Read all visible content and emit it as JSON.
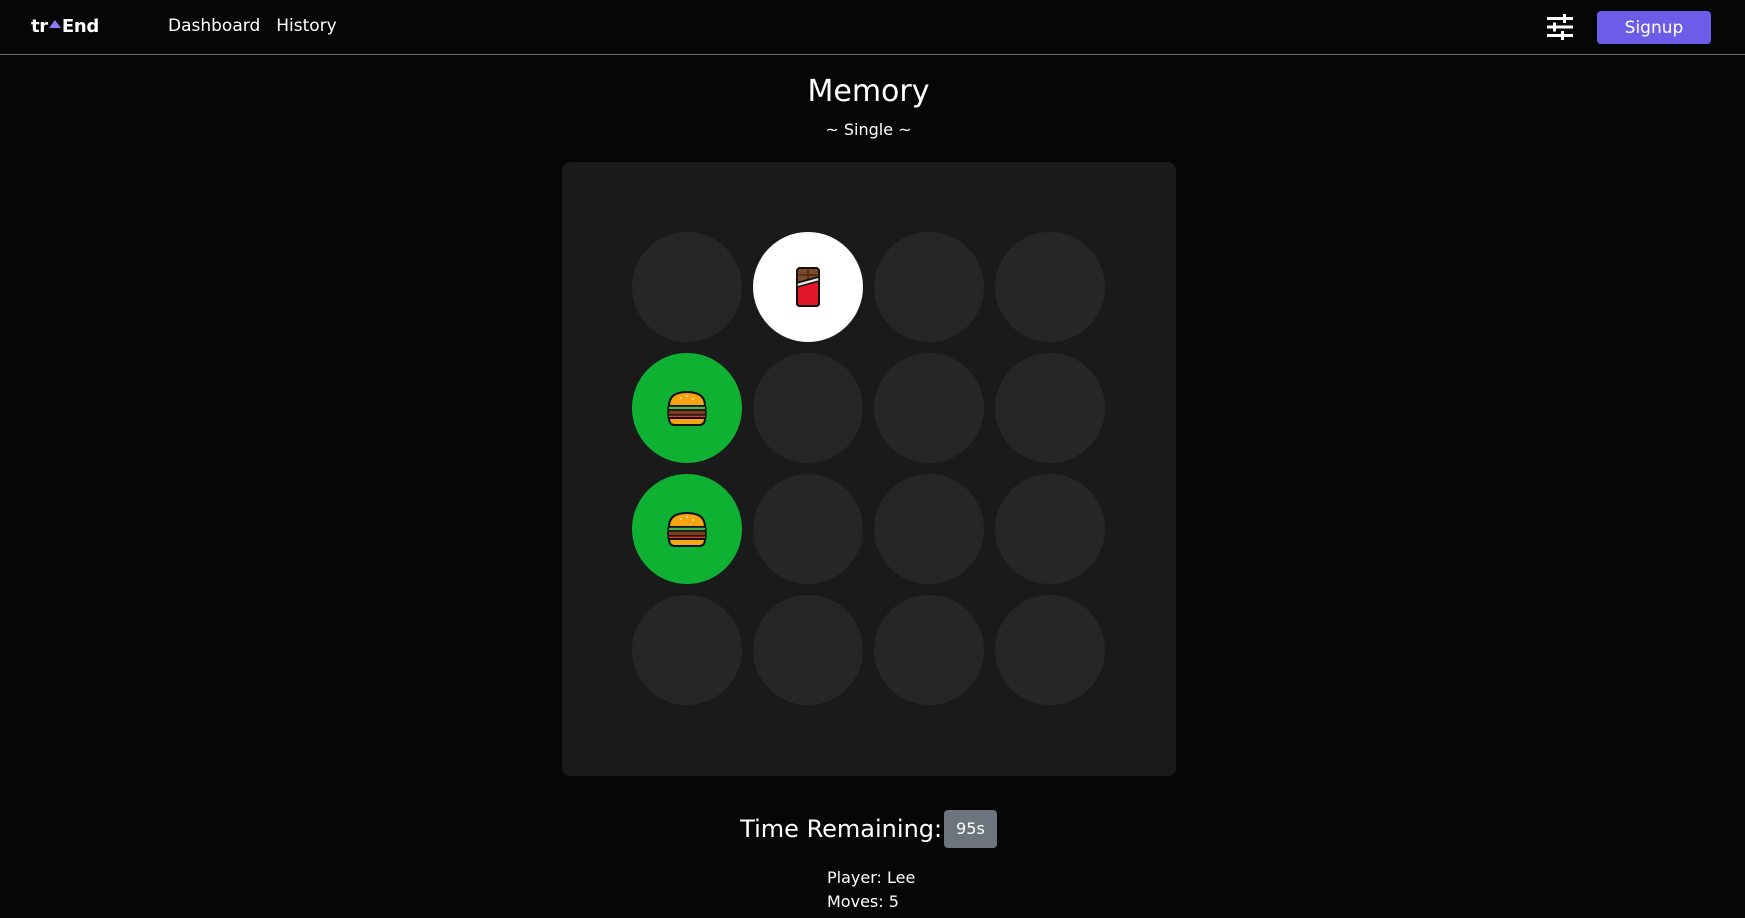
{
  "nav": {
    "logo_left": "tr",
    "logo_right": "End",
    "links": [
      "Dashboard",
      "History"
    ],
    "signup_label": "Signup",
    "settings_icon": "sliders-icon"
  },
  "game": {
    "title": "Memory",
    "mode": "~ Single ~",
    "cards": [
      {
        "state": "hidden",
        "icon": ""
      },
      {
        "state": "revealed",
        "icon": "chocolate-bar-icon"
      },
      {
        "state": "hidden",
        "icon": ""
      },
      {
        "state": "hidden",
        "icon": ""
      },
      {
        "state": "matched",
        "icon": "burger-icon"
      },
      {
        "state": "hidden",
        "icon": ""
      },
      {
        "state": "hidden",
        "icon": ""
      },
      {
        "state": "hidden",
        "icon": ""
      },
      {
        "state": "matched",
        "icon": "burger-icon"
      },
      {
        "state": "hidden",
        "icon": ""
      },
      {
        "state": "hidden",
        "icon": ""
      },
      {
        "state": "hidden",
        "icon": ""
      },
      {
        "state": "hidden",
        "icon": ""
      },
      {
        "state": "hidden",
        "icon": ""
      },
      {
        "state": "hidden",
        "icon": ""
      },
      {
        "state": "hidden",
        "icon": ""
      }
    ],
    "colors": {
      "hidden": "#262626",
      "revealed": "#ffffff",
      "matched": "#0fb133",
      "accent": "#6c5ce7"
    }
  },
  "status": {
    "time_label": "Time Remaining:",
    "time_value": "95s",
    "player_line": "Player: Lee",
    "moves_line": "Moves: 5"
  }
}
